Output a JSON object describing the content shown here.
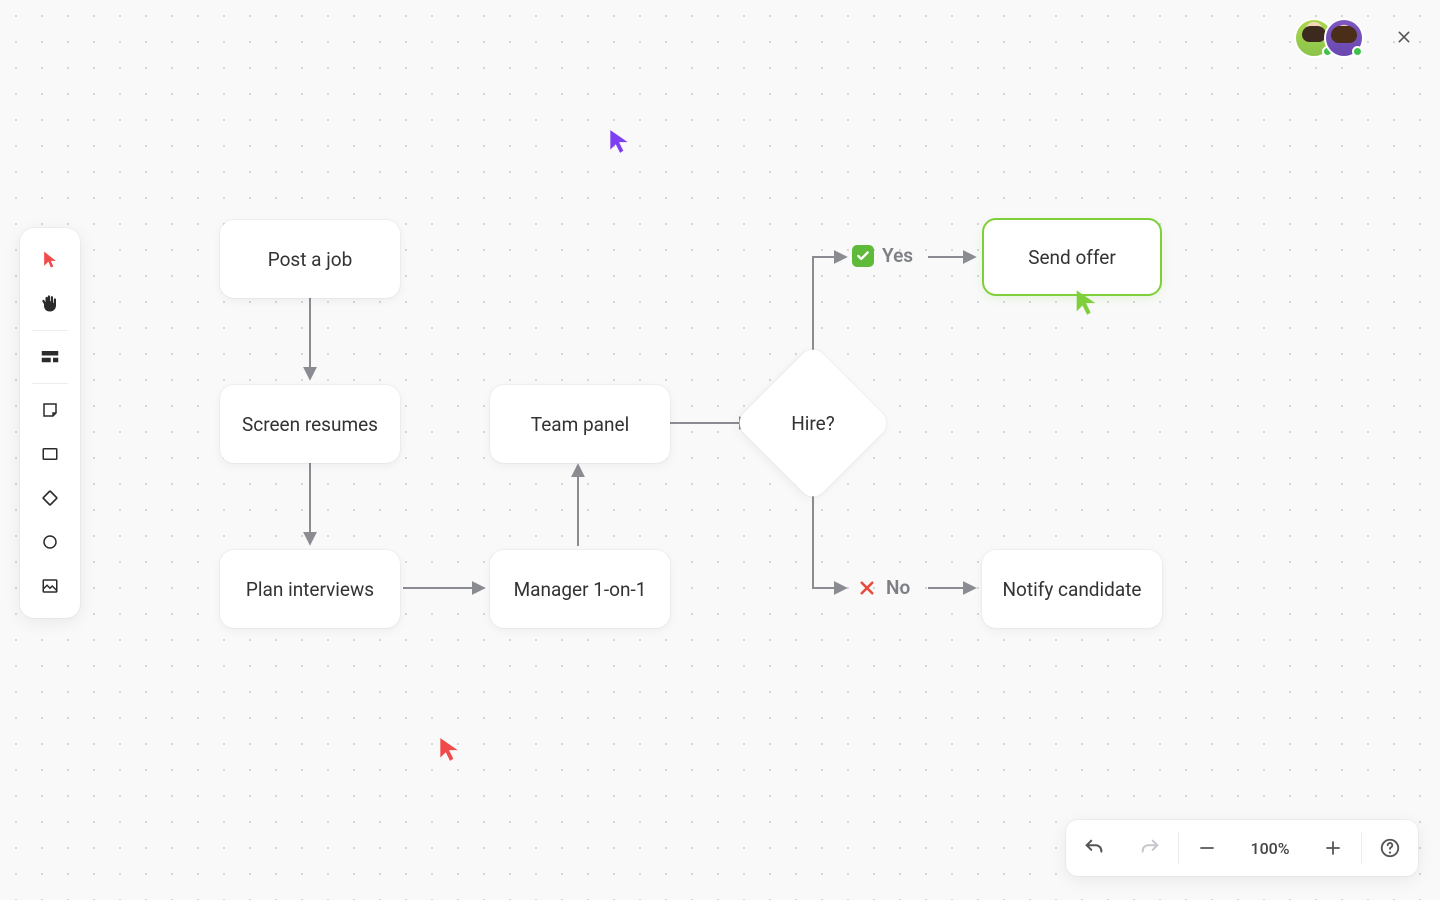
{
  "nodes": {
    "post_job": "Post a job",
    "screen_resumes": "Screen resumes",
    "plan_interviews": "Plan interviews",
    "manager_1on1": "Manager 1-on-1",
    "team_panel": "Team panel",
    "hire": "Hire?",
    "send_offer": "Send offer",
    "notify_candidate": "Notify candidate"
  },
  "branches": {
    "yes": "Yes",
    "no": "No"
  },
  "controls": {
    "zoom": "100%"
  },
  "colors": {
    "selected_border": "#7fcf3b",
    "yes": "#5fba3a",
    "no": "#e74c3c",
    "cursor_purple": "#7e3ff2",
    "cursor_red": "#f04a4a",
    "cursor_green": "#7fcf3b"
  },
  "collaborators": [
    {
      "name": "avatar-1",
      "online": true
    },
    {
      "name": "avatar-2",
      "online": true
    }
  ],
  "tools": [
    "pointer",
    "hand",
    "section",
    "sticky-note",
    "rectangle",
    "diamond",
    "circle",
    "image"
  ]
}
